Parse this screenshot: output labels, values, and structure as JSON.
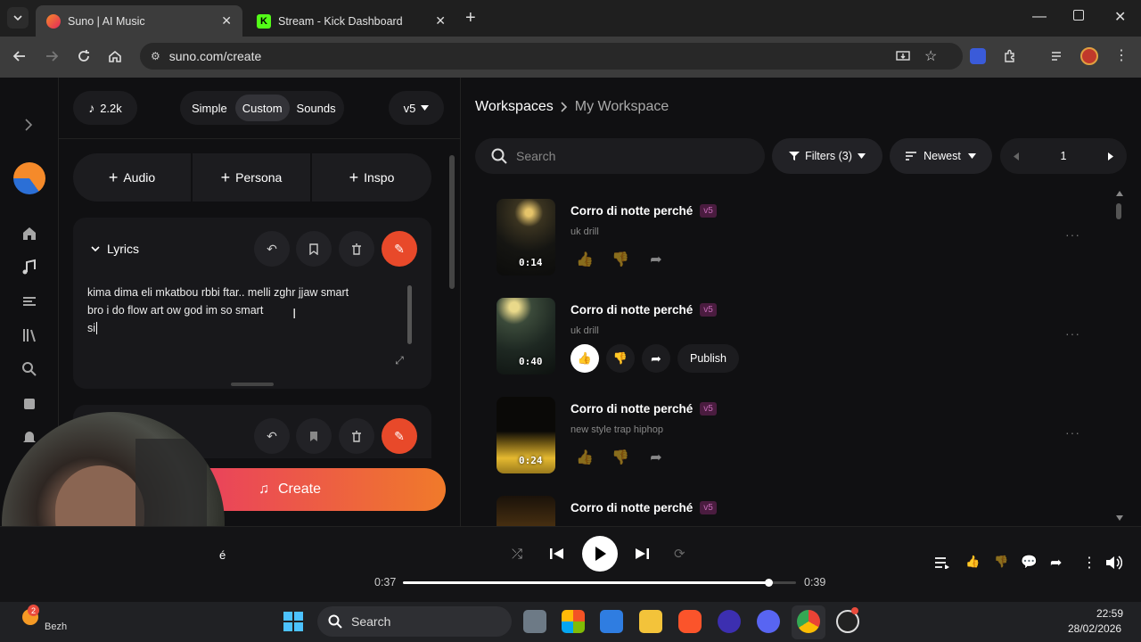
{
  "browser": {
    "tabs": [
      {
        "title": "Suno | AI Music",
        "favicon": "suno-favicon"
      },
      {
        "title": "Stream - Kick Dashboard",
        "favicon": "kick-favicon"
      }
    ],
    "url": "suno.com/create"
  },
  "creator": {
    "credits": "2.2k",
    "modes": [
      "Simple",
      "Custom",
      "Sounds"
    ],
    "active_mode": "Custom",
    "version": "v5",
    "add_buttons": [
      "Audio",
      "Persona",
      "Inspo"
    ],
    "lyrics_label": "Lyrics",
    "lyrics_lines": [
      "kima dima eli mkatbou rbbi ftar.. melli zghr jjaw smart",
      "bro i do flow art ow god im so smart",
      "si"
    ],
    "create_label": "Create"
  },
  "workspace": {
    "breadcrumb_root": "Workspaces",
    "breadcrumb_current": "My Workspace",
    "search_placeholder": "Search",
    "filters_label": "Filters (3)",
    "sort_label": "Newest",
    "page": "1",
    "songs": [
      {
        "title": "Corro di notte perché",
        "version": "v5",
        "tag": "uk drill",
        "duration": "0:14"
      },
      {
        "title": "Corro di notte perché",
        "version": "v5",
        "tag": "uk drill",
        "duration": "0:40",
        "publish": "Publish"
      },
      {
        "title": "Corro di notte perché",
        "version": "v5",
        "tag": "new style trap hiphop",
        "duration": "0:24"
      },
      {
        "title": "Corro di notte perché",
        "version": "v5",
        "tag": "",
        "duration": ""
      }
    ]
  },
  "player": {
    "elapsed": "0:37",
    "total": "0:39",
    "progress": 0.93,
    "now_playing_fragment": "é"
  },
  "taskbar": {
    "search_label": "Search",
    "time": "22:59",
    "date": "28/02/2026",
    "weather_text": "Bezh",
    "notification_count": "2"
  },
  "colors": {
    "accent": "#e8492a",
    "create_gradient_start": "#e8326a",
    "create_gradient_end": "#f07a2a"
  }
}
